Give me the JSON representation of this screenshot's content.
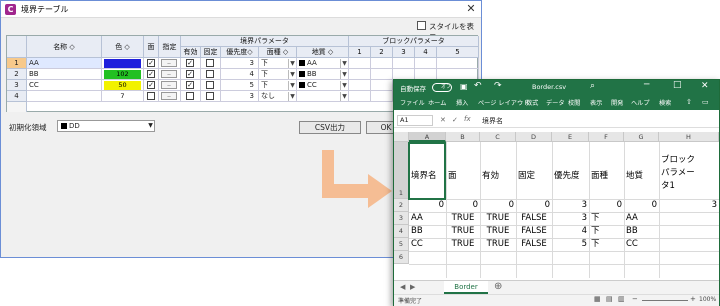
{
  "dialog": {
    "title": "境界テーブル",
    "close_glyph": "✕",
    "show_style_label": "スタイルを表示",
    "headers": {
      "name": "名称",
      "color": "色",
      "face": "面",
      "specify": "指定",
      "boundary_params": "境界パラメータ",
      "valid": "有効",
      "fixed": "固定",
      "priority": "優先度",
      "face_type": "面種",
      "material": "地質",
      "block_params": "ブロックパラメータ",
      "block_cols": [
        "1",
        "2",
        "3",
        "4",
        "5"
      ]
    },
    "rows": [
      {
        "num": "1",
        "name": "AA",
        "color_value": "",
        "color_hex": "#1f1fdc",
        "priority": "3",
        "face_type": "下",
        "material": "AA"
      },
      {
        "num": "2",
        "name": "BB",
        "color_value": "102",
        "color_hex": "#22c022",
        "priority": "4",
        "face_type": "下",
        "material": "BB"
      },
      {
        "num": "3",
        "name": "CC",
        "color_value": "50",
        "color_hex": "#f2f200",
        "priority": "5",
        "face_type": "下",
        "material": "CC"
      },
      {
        "num": "4",
        "name": "",
        "color_value": "7",
        "color_hex": "#ffffff",
        "priority": "3",
        "face_type": "なし",
        "material": ""
      }
    ],
    "init_label": "初期化領域",
    "init_value": "DD",
    "csv_button": "CSV出力",
    "ok_button": "OK"
  },
  "excel": {
    "autosave_label": "自動保存",
    "toggle_state": "オフ",
    "file_name": "Border.csv",
    "menu": [
      "ファイル",
      "ホーム",
      "挿入",
      "ページ レイアウト",
      "数式",
      "データ",
      "校閲",
      "表示",
      "開発",
      "ヘルプ",
      "検索"
    ],
    "name_box": "A1",
    "formula": "境界名",
    "columns": [
      "A",
      "B",
      "C",
      "D",
      "E",
      "F",
      "G",
      "H"
    ],
    "row_numbers": [
      "1",
      "2",
      "3",
      "4",
      "5",
      "6"
    ],
    "header_row": [
      "境界名",
      "面",
      "有効",
      "固定",
      "優先度",
      "面種",
      "地質",
      "ブロック\nパラメー\nタ1"
    ],
    "row2": [
      "0",
      "0",
      "0",
      "0",
      "3",
      "0",
      "0",
      "3"
    ],
    "data_rows": [
      [
        "AA",
        "TRUE",
        "TRUE",
        "FALSE",
        "3",
        "下",
        "AA"
      ],
      [
        "BB",
        "TRUE",
        "TRUE",
        "FALSE",
        "4",
        "下",
        "BB"
      ],
      [
        "CC",
        "TRUE",
        "TRUE",
        "FALSE",
        "5",
        "下",
        "CC"
      ]
    ],
    "sheet_tab": "Border",
    "status_ready": "準備完了",
    "zoom": "100%",
    "accent": "#217346"
  }
}
